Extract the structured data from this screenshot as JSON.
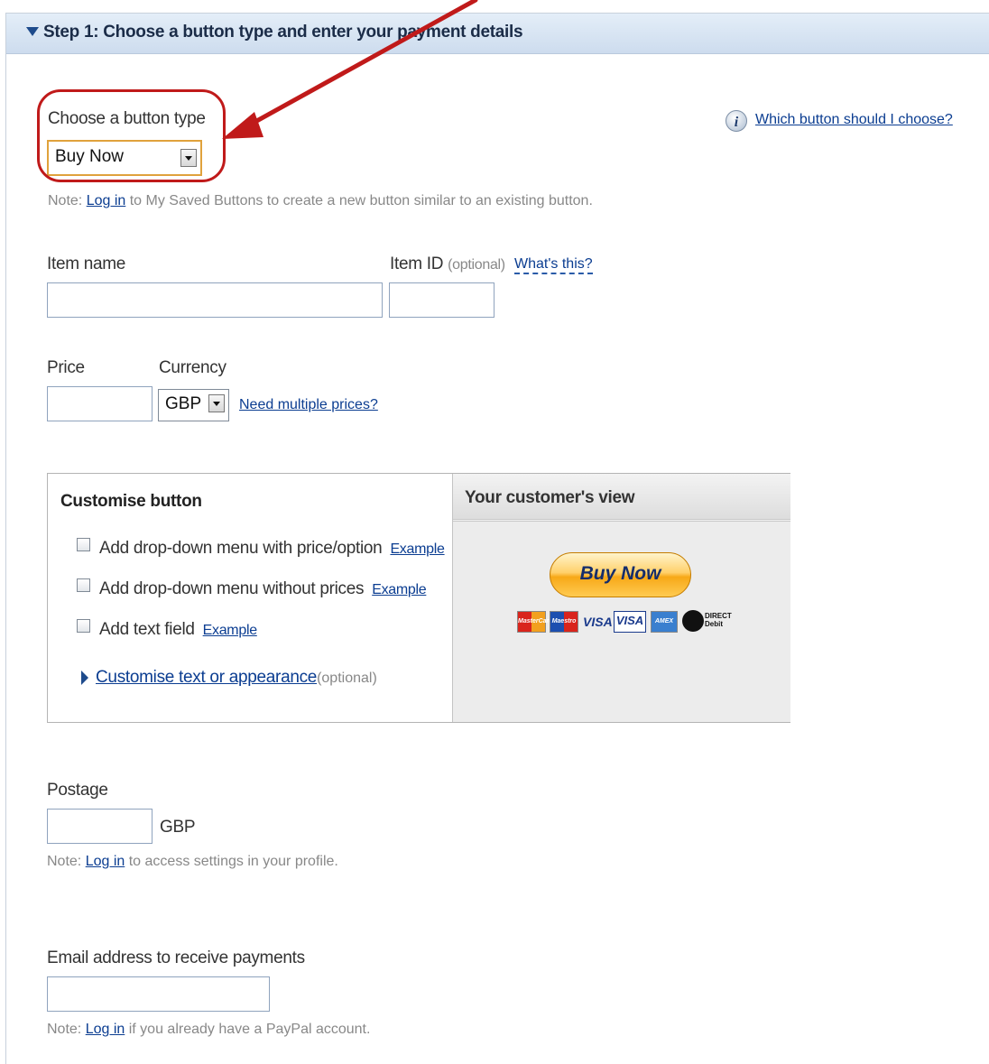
{
  "step": {
    "title": "Step 1: Choose a button type and enter your payment details"
  },
  "button_type": {
    "label": "Choose a button type",
    "selected": "Buy Now",
    "help_link": "Which button should I choose?",
    "note_prefix": "Note: ",
    "note_link": "Log in",
    "note_suffix": " to My Saved Buttons to create a new button similar to an existing button."
  },
  "item": {
    "name_label": "Item name",
    "id_label": "Item ID",
    "id_optional": "(optional)",
    "whats_this": "What's this?"
  },
  "price": {
    "price_label": "Price",
    "currency_label": "Currency",
    "currency_selected": "GBP",
    "multiple_prices_link": "Need multiple prices?"
  },
  "customise": {
    "title": "Customise button",
    "options": [
      {
        "label": "Add drop-down menu with price/option",
        "example": "Example"
      },
      {
        "label": "Add drop-down menu without prices",
        "example": "Example"
      },
      {
        "label": "Add text field",
        "example": "Example"
      }
    ],
    "appearance_link": "Customise text or appearance",
    "appearance_optional": "(optional)"
  },
  "preview": {
    "title": "Your customer's view",
    "button_label": "Buy Now",
    "cards": [
      "MasterCard",
      "Maestro",
      "VISA",
      "VISA",
      "AMEX",
      "DIRECT Debit"
    ]
  },
  "postage": {
    "label": "Postage",
    "currency": "GBP",
    "note_prefix": "Note: ",
    "note_link": "Log in",
    "note_suffix": " to access settings in your profile."
  },
  "email": {
    "label": "Email address to receive payments",
    "note_prefix": "Note: ",
    "note_link": "Log in",
    "note_suffix": " if you already have a PayPal account."
  },
  "colors": {
    "link": "#0b3d91",
    "header_bg": "#d6e3f2",
    "annotation_red": "#c01a1a",
    "button_orange": "#f7a817"
  }
}
